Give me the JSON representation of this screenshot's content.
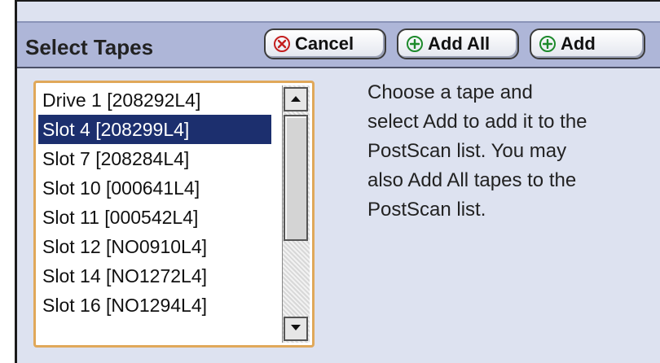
{
  "header": {
    "title": "Select Tapes",
    "buttons": {
      "cancel_label": "Cancel",
      "add_all_label": "Add All",
      "add_label": "Add"
    }
  },
  "tape_list": {
    "items": [
      "Drive 1 [208292L4]",
      "Slot 4 [208299L4]",
      "Slot 7 [208284L4]",
      "Slot 10 [000641L4]",
      "Slot 11 [000542L4]",
      "Slot 12 [NO0910L4]",
      "Slot 14 [NO1272L4]",
      "Slot 16 [NO1294L4]"
    ],
    "selected": "Slot 4 [208299L4]"
  },
  "instructions": {
    "lines": [
      "Choose a tape and",
      "select Add to add it to the",
      "PostScan list. You may",
      "also Add All tapes to the",
      "PostScan list."
    ]
  },
  "icons": {
    "cancel": "cancel-circle-x-icon",
    "add": "add-circle-plus-icon",
    "scroll_up": "arrow-up-icon",
    "scroll_down": "arrow-down-icon"
  },
  "colors": {
    "header_bg": "#aeb6d8",
    "panel_bg": "#dde2f0",
    "selection": "#1c2f6e",
    "list_border": "#e0a85a",
    "cancel_icon": "#c41e1e",
    "add_icon": "#1d8a2b"
  }
}
